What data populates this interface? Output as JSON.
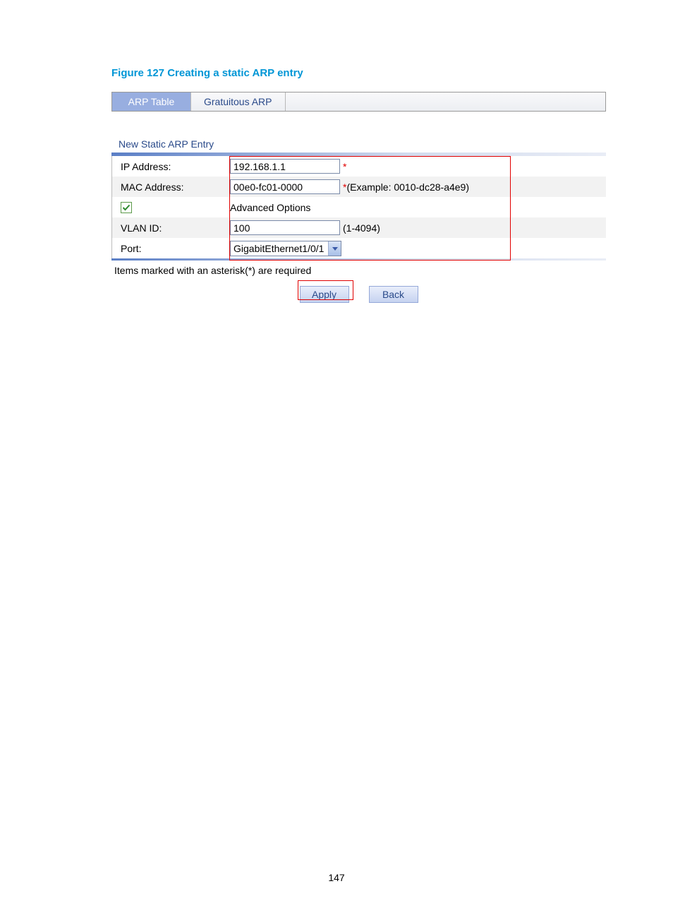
{
  "figure_title": "Figure 127 Creating a static ARP entry",
  "tabs": {
    "active": "ARP Table",
    "other": "Gratuitous ARP"
  },
  "section_title": "New Static ARP Entry",
  "form": {
    "ip_label": "IP Address:",
    "ip_value": "192.168.1.1",
    "ip_after": "*",
    "mac_label": "MAC Address:",
    "mac_value": "00e0-fc01-0000",
    "mac_after": "*(Example: 0010-dc28-a4e9)",
    "advanced_label": "Advanced Options",
    "vlan_label": "VLAN ID:",
    "vlan_value": "100",
    "vlan_after": "(1-4094)",
    "port_label": "Port:",
    "port_value": "GigabitEthernet1/0/1"
  },
  "required_note": "Items marked with an asterisk(*) are required",
  "buttons": {
    "apply": "Apply",
    "back": "Back"
  },
  "page_number": "147"
}
